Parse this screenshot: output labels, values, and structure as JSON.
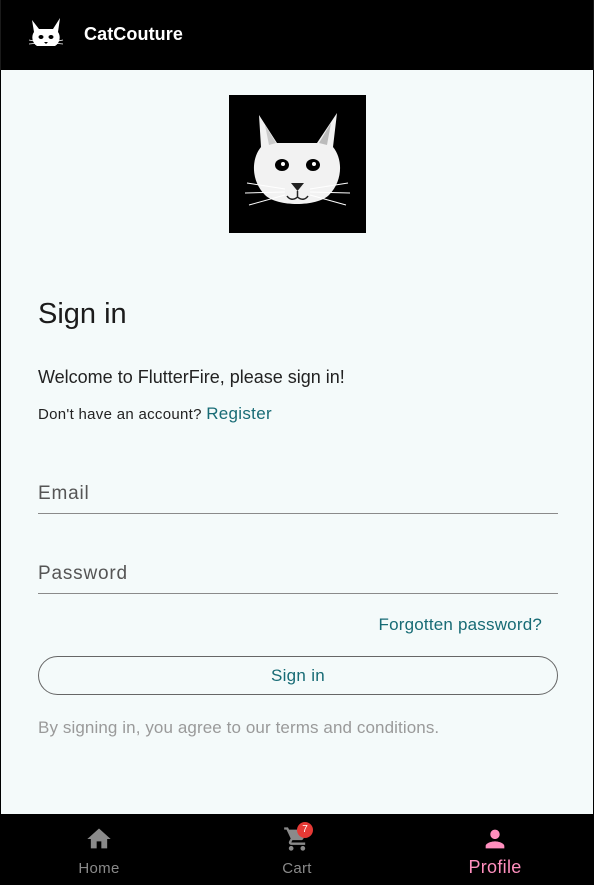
{
  "app": {
    "title": "CatCouture"
  },
  "signin": {
    "heading": "Sign in",
    "welcome": "Welcome to FlutterFire, please sign in!",
    "no_account_text": "Don't have an account?",
    "register_label": "Register",
    "email_placeholder": "Email",
    "password_placeholder": "Password",
    "forgot_label": "Forgotten password?",
    "button_label": "Sign in",
    "terms_text": "By signing in, you agree to our terms and conditions."
  },
  "nav": {
    "items": [
      {
        "label": "Home",
        "icon": "home-icon"
      },
      {
        "label": "Cart",
        "icon": "cart-icon",
        "badge": "7"
      },
      {
        "label": "Profile",
        "icon": "person-icon",
        "active": true
      }
    ]
  },
  "colors": {
    "accent": "#176b75",
    "active_nav": "#ff8fbe",
    "badge": "#e53935",
    "background": "#f4fafa"
  }
}
